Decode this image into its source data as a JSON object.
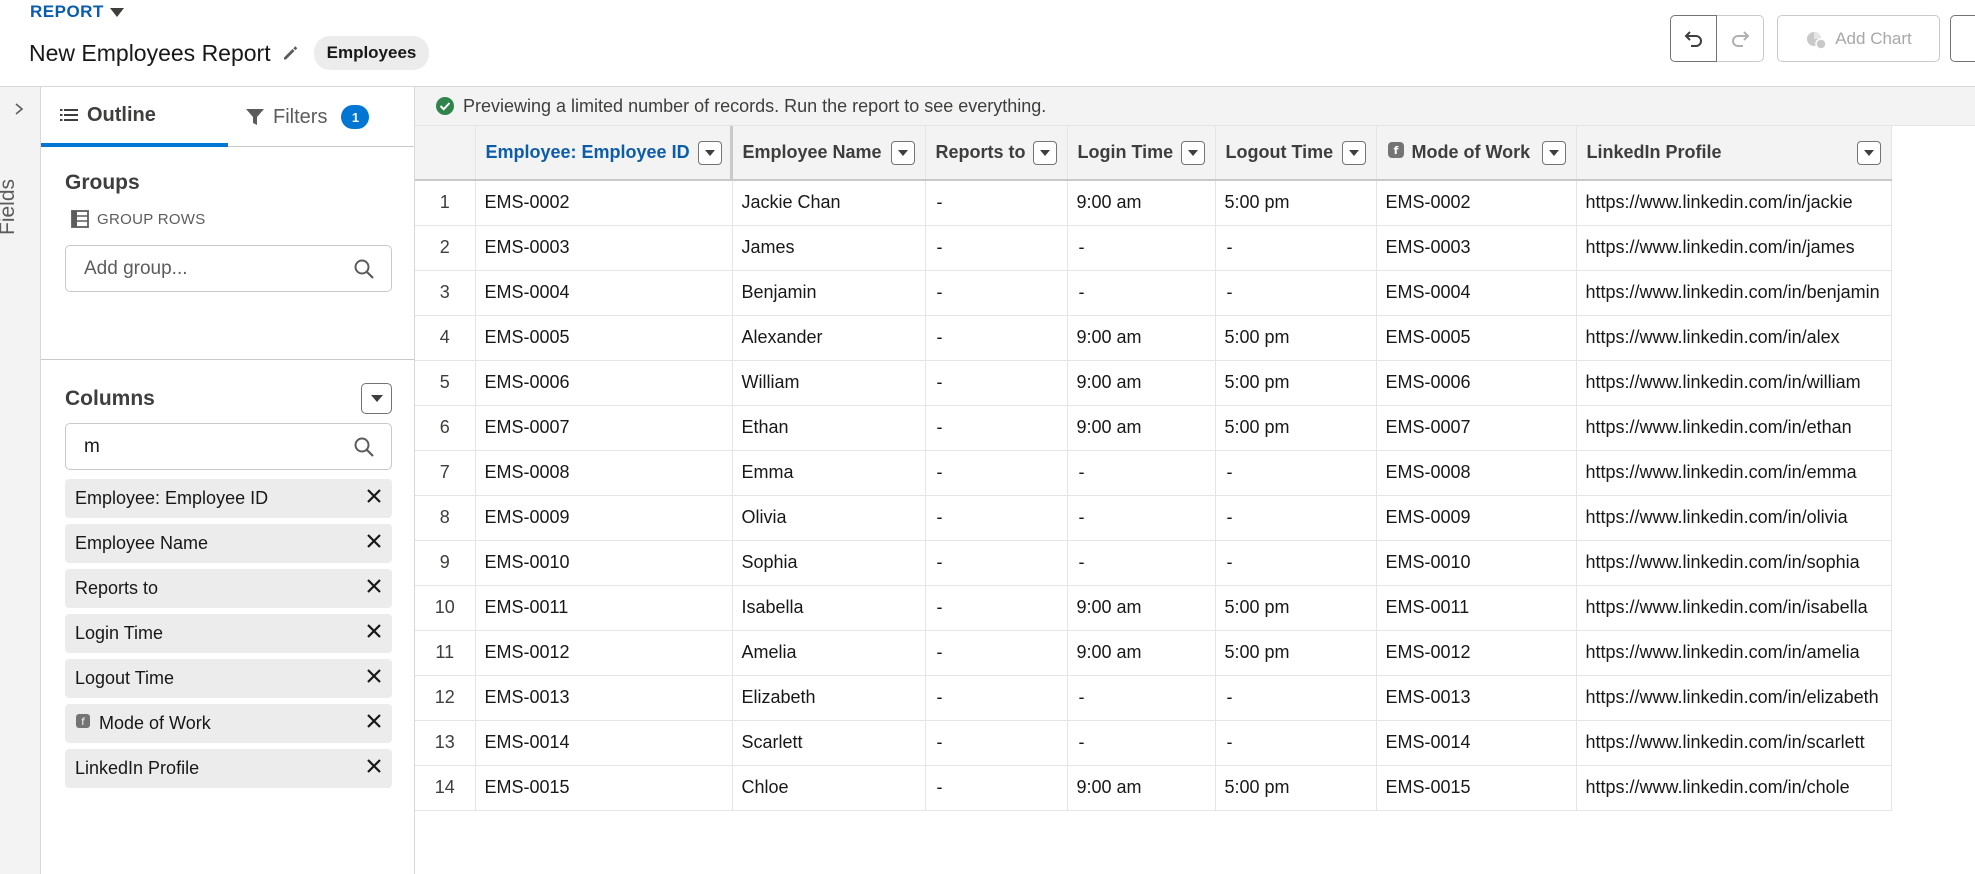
{
  "header": {
    "report_tag": "REPORT",
    "title": "New Employees Report",
    "object_badge": "Employees",
    "add_chart_label": "Add Chart"
  },
  "rail": {
    "label": "Fields"
  },
  "panel": {
    "tabs": {
      "outline": "Outline",
      "filters": "Filters",
      "filters_count": "1"
    },
    "groups": {
      "title": "Groups",
      "group_rows_label": "GROUP ROWS",
      "search_placeholder": "Add group..."
    },
    "columns": {
      "title": "Columns",
      "search_value": "m",
      "items": [
        {
          "label": "Employee: Employee ID",
          "icon": ""
        },
        {
          "label": "Employee Name",
          "icon": ""
        },
        {
          "label": "Reports to",
          "icon": ""
        },
        {
          "label": "Login Time",
          "icon": ""
        },
        {
          "label": "Logout Time",
          "icon": ""
        },
        {
          "label": "Mode of Work",
          "icon": "formula-icon"
        },
        {
          "label": "LinkedIn Profile",
          "icon": ""
        }
      ]
    }
  },
  "preview": {
    "message": "Previewing a limited number of records. Run the report to see everything."
  },
  "table": {
    "headers": [
      "Employee: Employee ID",
      "Employee Name",
      "Reports to",
      "Login Time",
      "Logout Time",
      "Mode of Work",
      "LinkedIn Profile"
    ],
    "rows": [
      [
        "1",
        "EMS-0002",
        "Jackie Chan",
        "-",
        "9:00 am",
        "5:00 pm",
        "EMS-0002",
        "https://www.linkedin.com/in/jackie"
      ],
      [
        "2",
        "EMS-0003",
        "James",
        "-",
        "-",
        "-",
        "EMS-0003",
        "https://www.linkedin.com/in/james"
      ],
      [
        "3",
        "EMS-0004",
        "Benjamin",
        "-",
        "-",
        "-",
        "EMS-0004",
        "https://www.linkedin.com/in/benjamin"
      ],
      [
        "4",
        "EMS-0005",
        "Alexander",
        "-",
        "9:00 am",
        "5:00 pm",
        "EMS-0005",
        "https://www.linkedin.com/in/alex"
      ],
      [
        "5",
        "EMS-0006",
        "William",
        "-",
        "9:00 am",
        "5:00 pm",
        "EMS-0006",
        "https://www.linkedin.com/in/william"
      ],
      [
        "6",
        "EMS-0007",
        "Ethan",
        "-",
        "9:00 am",
        "5:00 pm",
        "EMS-0007",
        "https://www.linkedin.com/in/ethan"
      ],
      [
        "7",
        "EMS-0008",
        "Emma",
        "-",
        "-",
        "-",
        "EMS-0008",
        "https://www.linkedin.com/in/emma"
      ],
      [
        "8",
        "EMS-0009",
        "Olivia",
        "-",
        "-",
        "-",
        "EMS-0009",
        "https://www.linkedin.com/in/olivia"
      ],
      [
        "9",
        "EMS-0010",
        "Sophia",
        "-",
        "-",
        "-",
        "EMS-0010",
        "https://www.linkedin.com/in/sophia"
      ],
      [
        "10",
        "EMS-0011",
        "Isabella",
        "-",
        "9:00 am",
        "5:00 pm",
        "EMS-0011",
        "https://www.linkedin.com/in/isabella"
      ],
      [
        "11",
        "EMS-0012",
        "Amelia",
        "-",
        "9:00 am",
        "5:00 pm",
        "EMS-0012",
        "https://www.linkedin.com/in/amelia"
      ],
      [
        "12",
        "EMS-0013",
        "Elizabeth",
        "-",
        "-",
        "-",
        "EMS-0013",
        "https://www.linkedin.com/in/elizabeth"
      ],
      [
        "13",
        "EMS-0014",
        "Scarlett",
        "-",
        "-",
        "-",
        "EMS-0014",
        "https://www.linkedin.com/in/scarlett"
      ],
      [
        "14",
        "EMS-0015",
        "Chloe",
        "-",
        "9:00 am",
        "5:00 pm",
        "EMS-0015",
        "https://www.linkedin.com/in/chole"
      ]
    ]
  },
  "colors": {
    "accent": "#0176d3",
    "link": "#0b5cab",
    "success": "#2e844a"
  }
}
